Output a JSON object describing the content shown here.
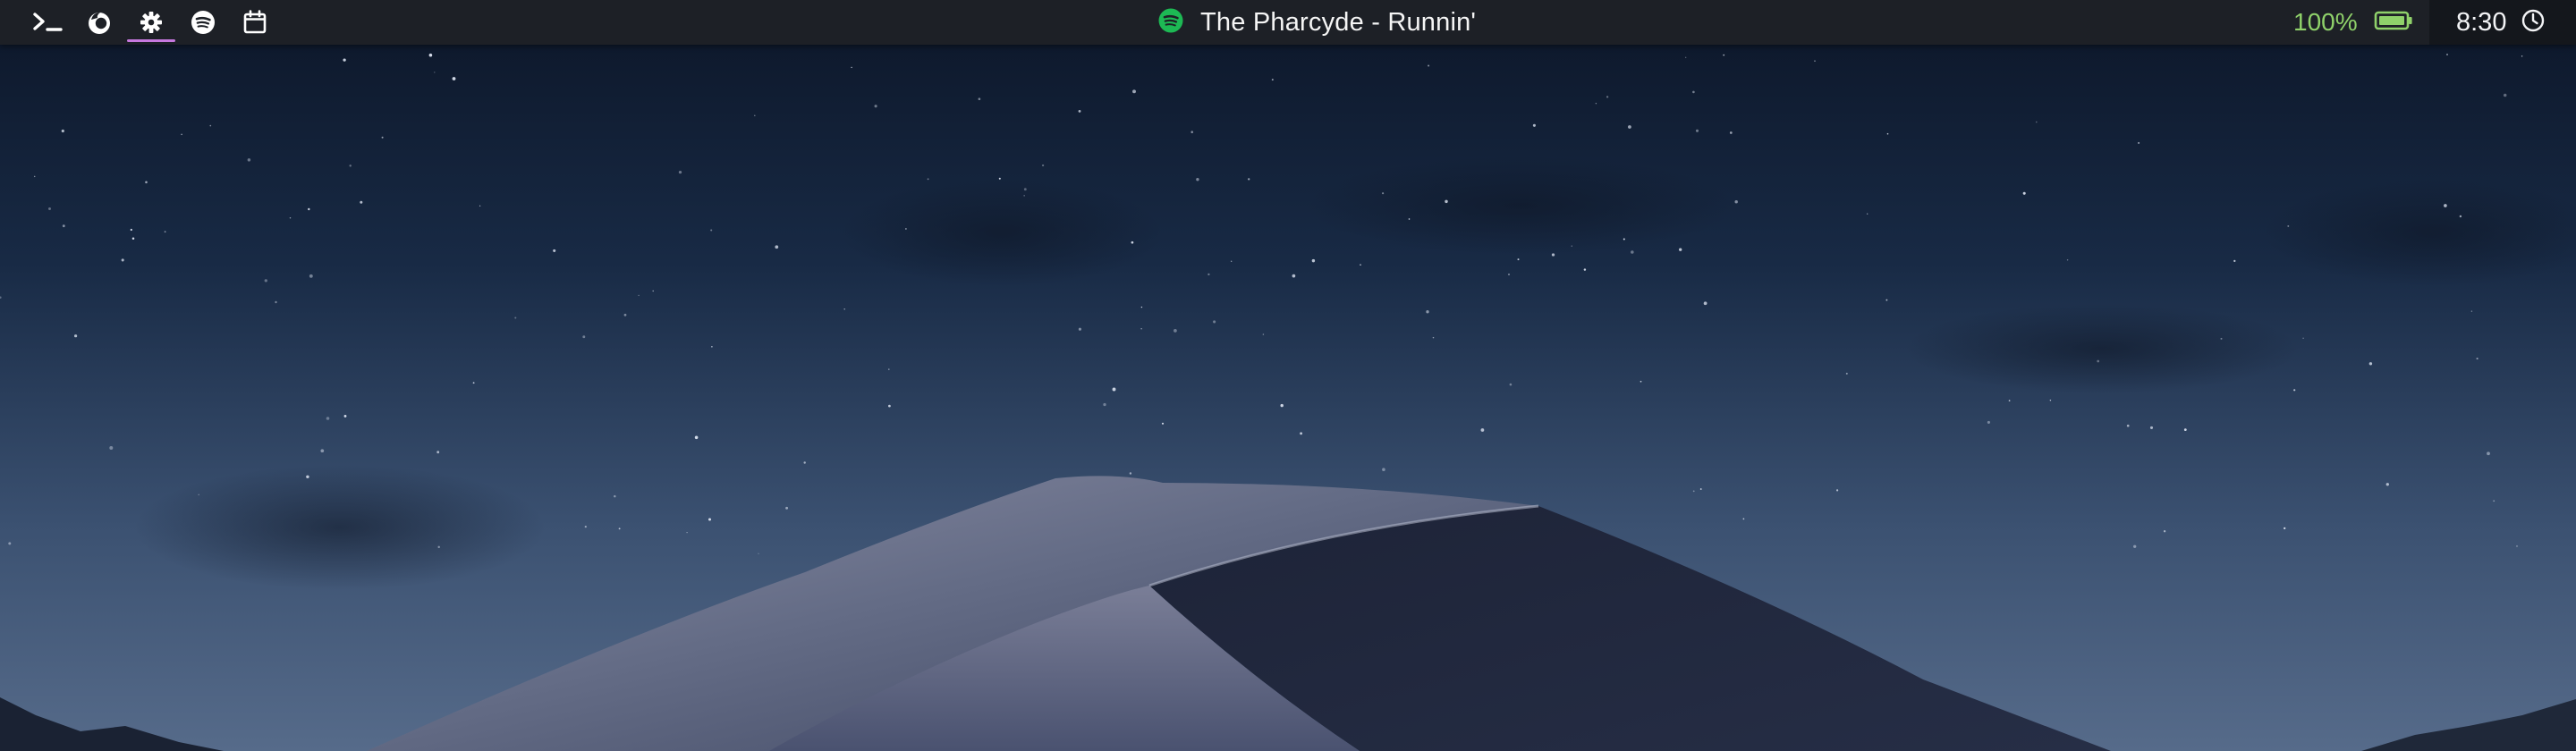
{
  "topbar": {
    "workspaces": [
      {
        "icon": "terminal-icon",
        "active": false
      },
      {
        "icon": "firefox-icon",
        "active": false
      },
      {
        "icon": "settings-gear-icon",
        "active": true
      },
      {
        "icon": "spotify-icon",
        "active": false
      },
      {
        "icon": "calendar-icon",
        "active": false
      }
    ],
    "now_playing": {
      "icon": "spotify-icon",
      "track": "The Pharcyde - Runnin'"
    },
    "battery": {
      "percent_label": "100%",
      "level": 1.0,
      "icon": "battery-icon"
    },
    "clock": {
      "time": "8:30",
      "icon": "clock-icon"
    }
  },
  "wallpaper": {
    "scene": "night-desert-dunes"
  },
  "colors": {
    "bar_background": "#1d2026",
    "clock_background": "#14171c",
    "active_workspace_indicator": "#c678dd",
    "spotify_green": "#1db954",
    "battery_green": "#8fd16a",
    "text": "#f3f4f6"
  }
}
